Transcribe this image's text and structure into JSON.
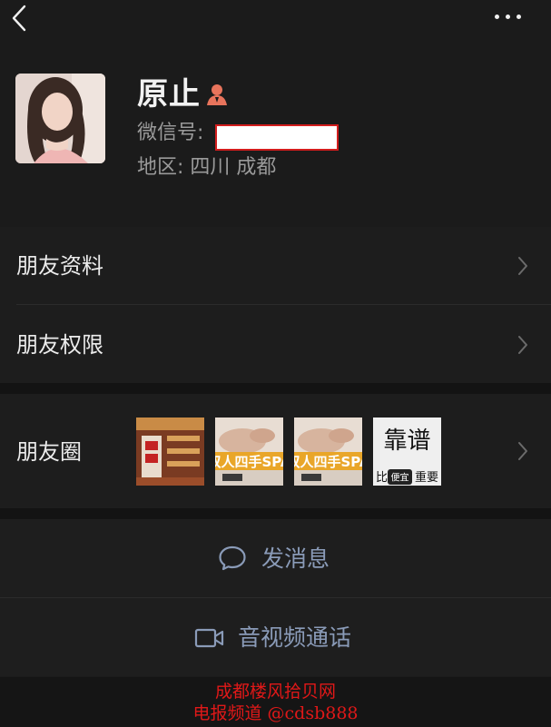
{
  "profile": {
    "name": "原止",
    "wechat_id_label": "微信号:",
    "region": "地区: 四川  成都"
  },
  "cells": {
    "friend_info": "朋友资料",
    "friend_permissions": "朋友权限",
    "moments": "朋友圈"
  },
  "moments_thumbs": [
    {
      "desc": "shop-shelf-photo"
    },
    {
      "text": "双人四手SPA"
    },
    {
      "text": "双人四手SPA"
    },
    {
      "text_top": "靠谱",
      "text_bottom_left": "比",
      "badge": "便宜",
      "text_bottom_right": "重要"
    }
  ],
  "actions": {
    "send_message": "发消息",
    "av_call": "音视频通话"
  },
  "watermark": {
    "line1": "成都楼风拾贝网",
    "line2": "电报频道 @cdsb888"
  },
  "colors": {
    "background": "#1b1b1b",
    "action_text": "#8a9bb8",
    "watermark": "#e01818",
    "redaction_border": "#d21d1d"
  }
}
